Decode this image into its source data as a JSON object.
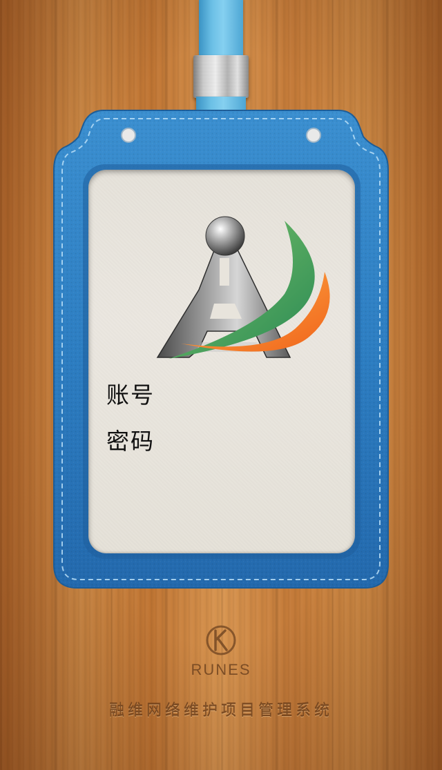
{
  "login": {
    "account_label": "账号",
    "account_value": "",
    "password_label": "密码",
    "password_value": ""
  },
  "brand": {
    "wordmark": "RUNES",
    "system_title": "融维网络维护项目管理系统"
  },
  "colors": {
    "badge_blue": "#2f7fc1",
    "strap_blue": "#6cc0e6",
    "card_bg": "#e8e4dc",
    "logo_green": "#3aa35c",
    "logo_orange": "#f57b22",
    "wood": "#c7803c",
    "title_text": "#7a4a22"
  },
  "icons": {
    "app_logo": "tower-a-logo-icon",
    "company_logo": "runes-logo-icon"
  }
}
